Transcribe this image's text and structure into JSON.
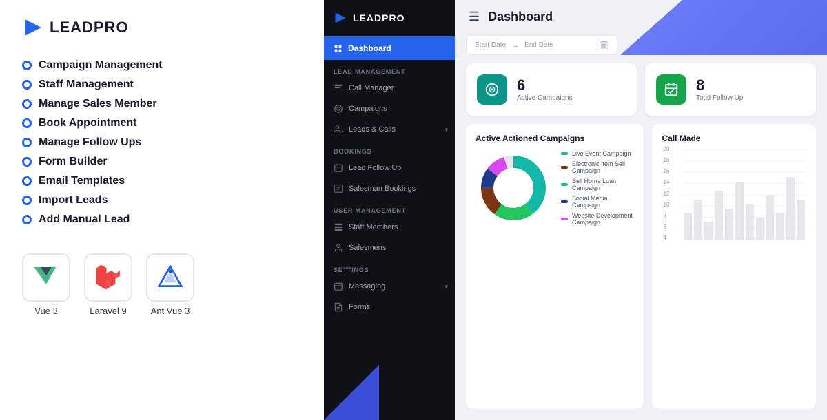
{
  "brand": {
    "name": "LEADPRO",
    "logo_alt": "LeadPro logo"
  },
  "left_nav": {
    "items": [
      {
        "label": "Campaign Management"
      },
      {
        "label": "Staff Management"
      },
      {
        "label": "Manage Sales Member"
      },
      {
        "label": "Book Appointment"
      },
      {
        "label": "Manage Follow Ups"
      },
      {
        "label": "Form Builder"
      },
      {
        "label": "Email Templates"
      },
      {
        "label": "Import Leads"
      },
      {
        "label": "Add Manual Lead"
      }
    ]
  },
  "tech_stack": [
    {
      "label": "Vue 3",
      "icon": "vue"
    },
    {
      "label": "Laravel 9",
      "icon": "laravel"
    },
    {
      "label": "Ant Vue 3",
      "icon": "antvue"
    }
  ],
  "sidebar": {
    "active_item": "Dashboard",
    "sections": [
      {
        "label": "Lead Management",
        "items": [
          {
            "label": "Call Manager"
          },
          {
            "label": "Campaigns"
          },
          {
            "label": "Leads & Calls",
            "has_arrow": true
          }
        ]
      },
      {
        "label": "Bookings",
        "items": [
          {
            "label": "Lead Follow Up"
          },
          {
            "label": "Salesman Bookings"
          }
        ]
      },
      {
        "label": "User Management",
        "items": [
          {
            "label": "Staff Members"
          },
          {
            "label": "Salesmens"
          }
        ]
      },
      {
        "label": "Settings",
        "items": [
          {
            "label": "Messaging",
            "has_arrow": true
          },
          {
            "label": "Forms"
          }
        ]
      }
    ]
  },
  "dashboard": {
    "title": "Dashboard",
    "date_filter": {
      "start_placeholder": "Start Date",
      "end_placeholder": "End Date"
    },
    "stats": [
      {
        "value": "6",
        "label": "Active Campaigns",
        "icon_type": "teal"
      },
      {
        "value": "8",
        "label": "Total Follow Up",
        "icon_type": "green"
      }
    ],
    "charts": [
      {
        "title": "Active Actioned Campaigns",
        "type": "donut",
        "legend": [
          {
            "label": "Live Event Campaign",
            "color": "#14b8a6"
          },
          {
            "label": "Electronic Item Sell Campaign",
            "color": "#92400e"
          },
          {
            "label": "Sell Home Loan Campaign",
            "color": "#22c55e"
          },
          {
            "label": "Social Media Campaign",
            "color": "#1e3a8a"
          },
          {
            "label": "Website Development Campaign",
            "color": "#d946ef"
          }
        ]
      },
      {
        "title": "Call Made",
        "type": "bar",
        "y_labels": [
          "20",
          "18",
          "16",
          "14",
          "12",
          "10",
          "8",
          "6",
          "4"
        ]
      }
    ]
  }
}
